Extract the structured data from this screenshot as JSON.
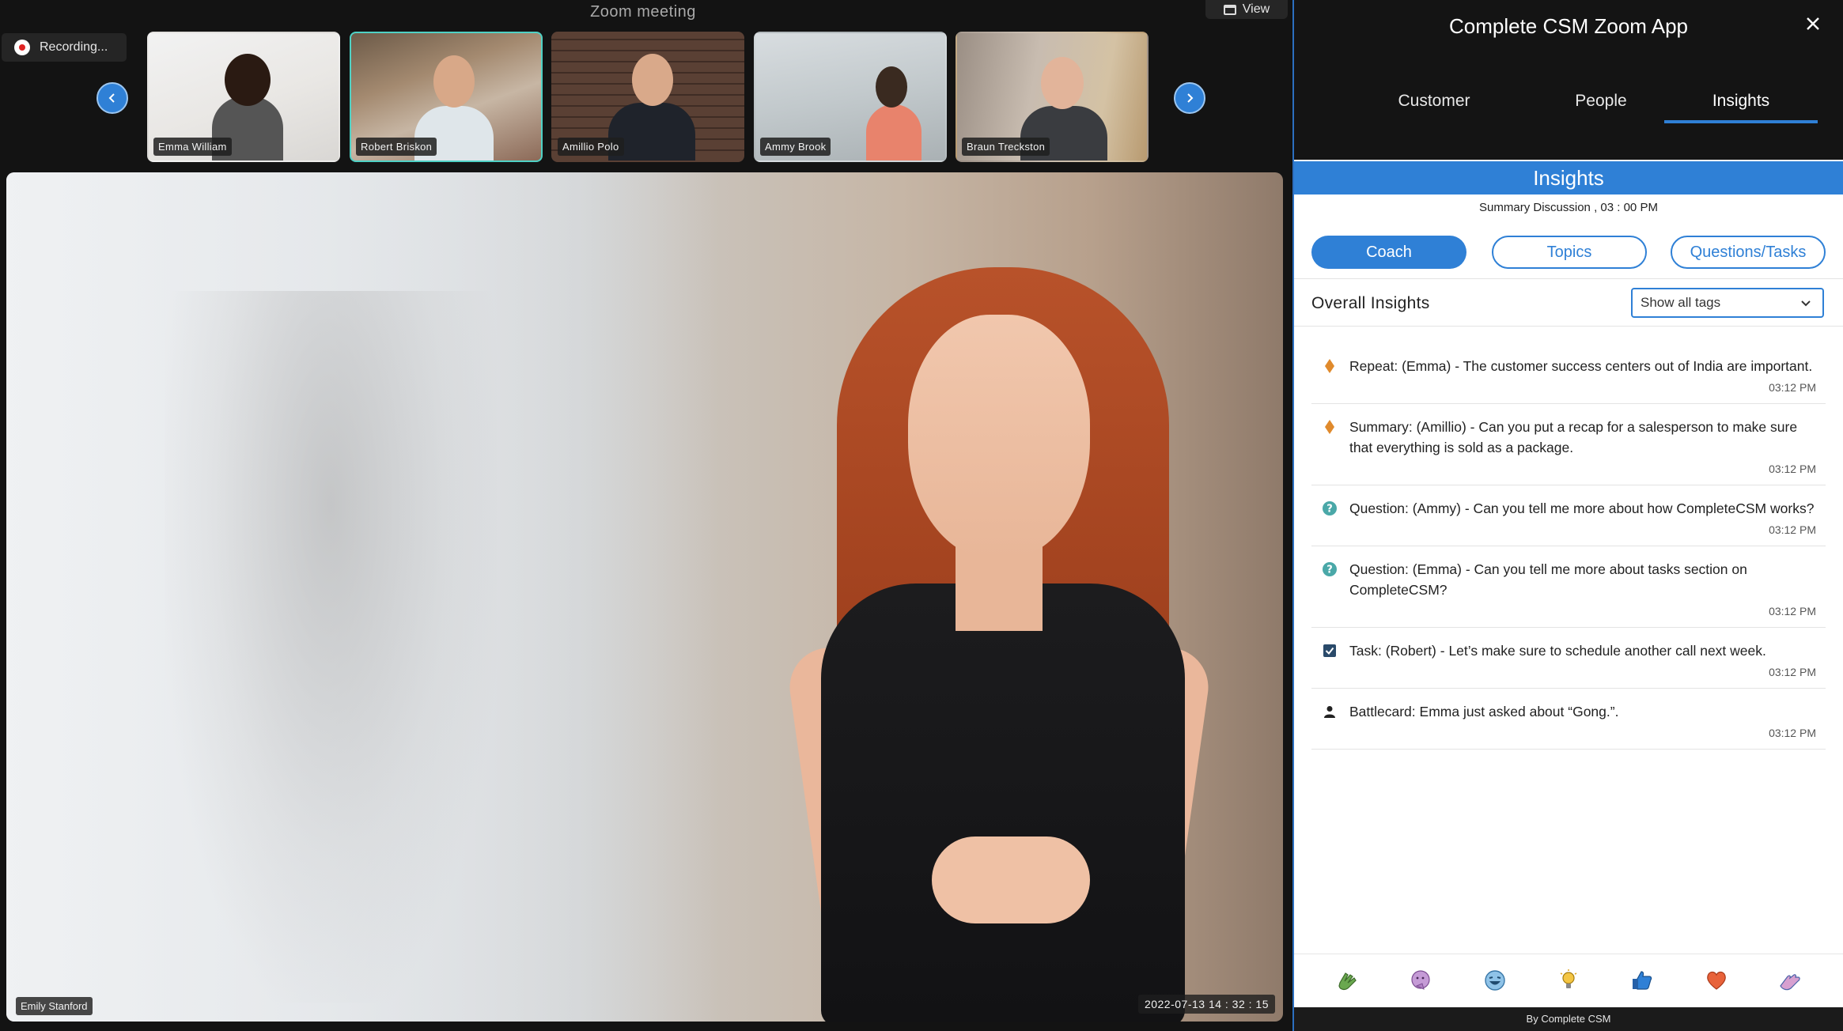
{
  "meeting": {
    "title": "Zoom meeting",
    "view_label": "View",
    "recording_label": "Recording...",
    "participants": [
      {
        "name": "Emma William",
        "active": false
      },
      {
        "name": "Robert Briskon",
        "active": true
      },
      {
        "name": "Amillio Polo",
        "active": false
      },
      {
        "name": "Ammy Brook",
        "active": false
      },
      {
        "name": "Braun Treckston",
        "active": false
      }
    ],
    "main_video": {
      "speaker": "Emily Stanford",
      "timestamp": "2022-07-13    14 : 32 : 15"
    }
  },
  "panel": {
    "title": "Complete CSM Zoom App",
    "tabs": [
      {
        "label": "Customer",
        "active": false
      },
      {
        "label": "People",
        "active": false
      },
      {
        "label": "Insights",
        "active": true
      }
    ],
    "section_title": "Insights",
    "summary_line": "Summary Discussion , 03 : 00 PM",
    "filters": {
      "coach": "Coach",
      "topics": "Topics",
      "questions": "Questions/Tasks"
    },
    "overall_label": "Overall Insights",
    "tag_select": "Show all tags",
    "insights": [
      {
        "icon": "diamond-icon",
        "text": "Repeat: (Emma) - The customer success centers out of India are important.",
        "time": "03:12 PM"
      },
      {
        "icon": "diamond-icon",
        "text": "Summary: (Amillio) - Can you put a recap for a salesperson to make sure that everything is sold as a package.",
        "time": "03:12 PM"
      },
      {
        "icon": "question-icon",
        "text": "Question: (Ammy) - Can you tell me more about how CompleteCSM works?",
        "time": "03:12 PM"
      },
      {
        "icon": "question-icon",
        "text": "Question: (Emma) - Can you tell me more about tasks section on CompleteCSM?",
        "time": "03:12 PM"
      },
      {
        "icon": "task-checkbox-icon",
        "text": "Task: (Robert) - Let’s make sure to schedule another call next week.",
        "time": "03:12 PM"
      },
      {
        "icon": "person-icon",
        "text": "Battlecard: Emma just asked about “Gong.”.",
        "time": "03:12 PM"
      }
    ],
    "reactions": [
      "clap-icon",
      "thinking-icon",
      "laugh-icon",
      "lightbulb-icon",
      "thumbs-up-icon",
      "heart-icon",
      "raised-hand-icon"
    ],
    "footer": "By Complete CSM"
  },
  "colors": {
    "accent": "#2f80d6",
    "active_thumb_border": "#4fd1c5",
    "recording_red": "#e02424",
    "diamond_orange": "#e08a2c",
    "question_teal": "#4aa8a8"
  }
}
